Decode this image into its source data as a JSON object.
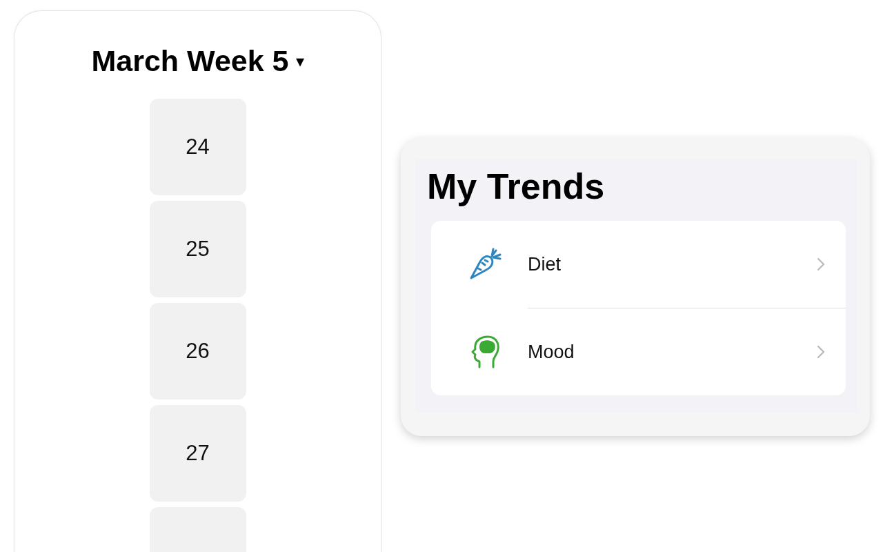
{
  "week_picker": {
    "title": "March Week 5",
    "caret": "▾",
    "days": [
      {
        "label": "24"
      },
      {
        "label": "25"
      },
      {
        "label": "26"
      },
      {
        "label": "27"
      }
    ],
    "more_below": true
  },
  "trends": {
    "title": "My Trends",
    "items": [
      {
        "label": "Diet",
        "kind": "diet",
        "color": "#2e86c1"
      },
      {
        "label": "Mood",
        "kind": "mood",
        "color": "#3aaa35"
      }
    ]
  }
}
